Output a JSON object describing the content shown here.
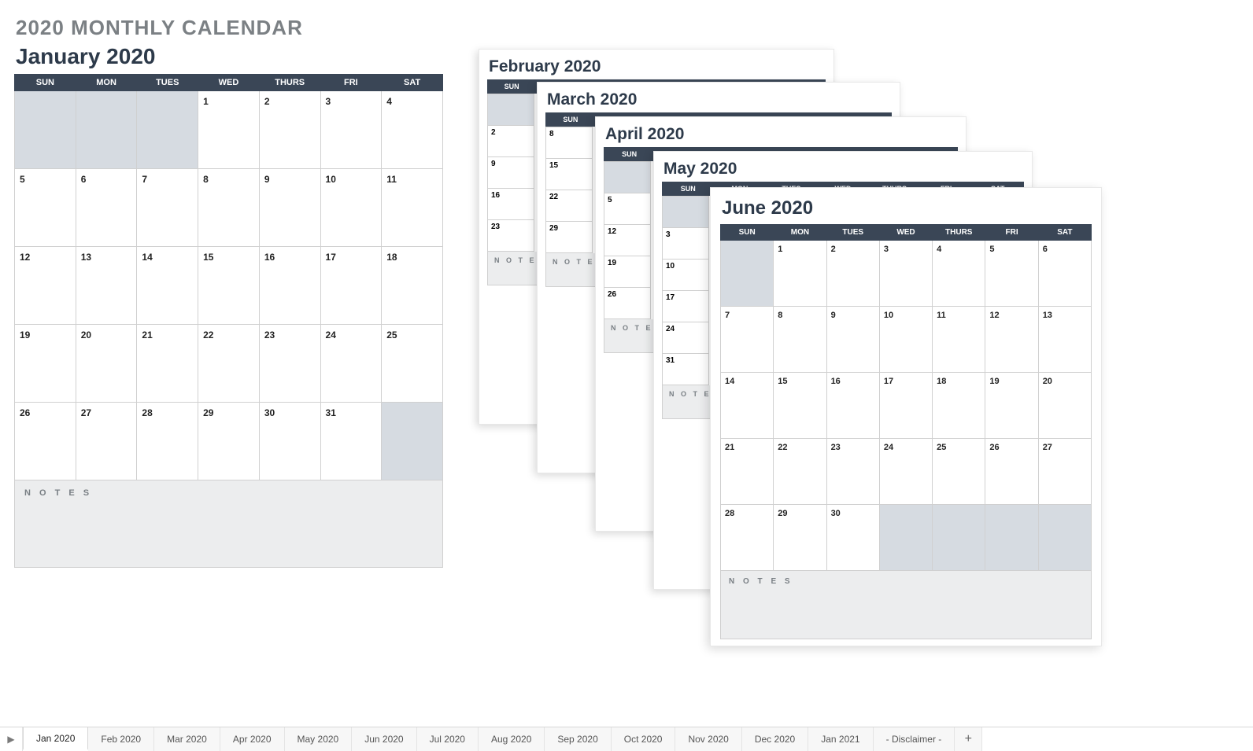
{
  "page_title": "2020 MONTHLY CALENDAR",
  "day_headers": [
    "SUN",
    "MON",
    "TUES",
    "WED",
    "THURS",
    "FRI",
    "SAT"
  ],
  "notes_label": "N O T E S",
  "january": {
    "title": "January 2020",
    "grid": [
      [
        "",
        "",
        "",
        "1",
        "2",
        "3",
        "4"
      ],
      [
        "5",
        "6",
        "7",
        "8",
        "9",
        "10",
        "11"
      ],
      [
        "12",
        "13",
        "14",
        "15",
        "16",
        "17",
        "18"
      ],
      [
        "19",
        "20",
        "21",
        "22",
        "23",
        "24",
        "25"
      ],
      [
        "26",
        "27",
        "28",
        "29",
        "30",
        "31",
        ""
      ]
    ]
  },
  "february": {
    "title": "February 2020",
    "col_values": [
      "",
      "2",
      "9",
      "16",
      "23"
    ]
  },
  "march": {
    "title": "March 2020",
    "col_values": [
      "8",
      "15",
      "22",
      "29"
    ]
  },
  "april": {
    "title": "April 2020",
    "col_values": [
      "5",
      "12",
      "19",
      "26"
    ]
  },
  "may": {
    "title": "May 2020",
    "col_values": [
      "3",
      "10",
      "17",
      "24",
      "31"
    ]
  },
  "june": {
    "title": "June 2020",
    "grid": [
      [
        "",
        "1",
        "2",
        "3",
        "4",
        "5",
        "6"
      ],
      [
        "7",
        "8",
        "9",
        "10",
        "11",
        "12",
        "13"
      ],
      [
        "14",
        "15",
        "16",
        "17",
        "18",
        "19",
        "20"
      ],
      [
        "21",
        "22",
        "23",
        "24",
        "25",
        "26",
        "27"
      ],
      [
        "28",
        "29",
        "30",
        "",
        "",
        "",
        ""
      ]
    ]
  },
  "tabs": [
    "Jan 2020",
    "Feb 2020",
    "Mar 2020",
    "Apr 2020",
    "May 2020",
    "Jun 2020",
    "Jul 2020",
    "Aug 2020",
    "Sep 2020",
    "Oct 2020",
    "Nov 2020",
    "Dec 2020",
    "Jan 2021",
    "- Disclaimer -"
  ],
  "active_tab": "Jan 2020"
}
